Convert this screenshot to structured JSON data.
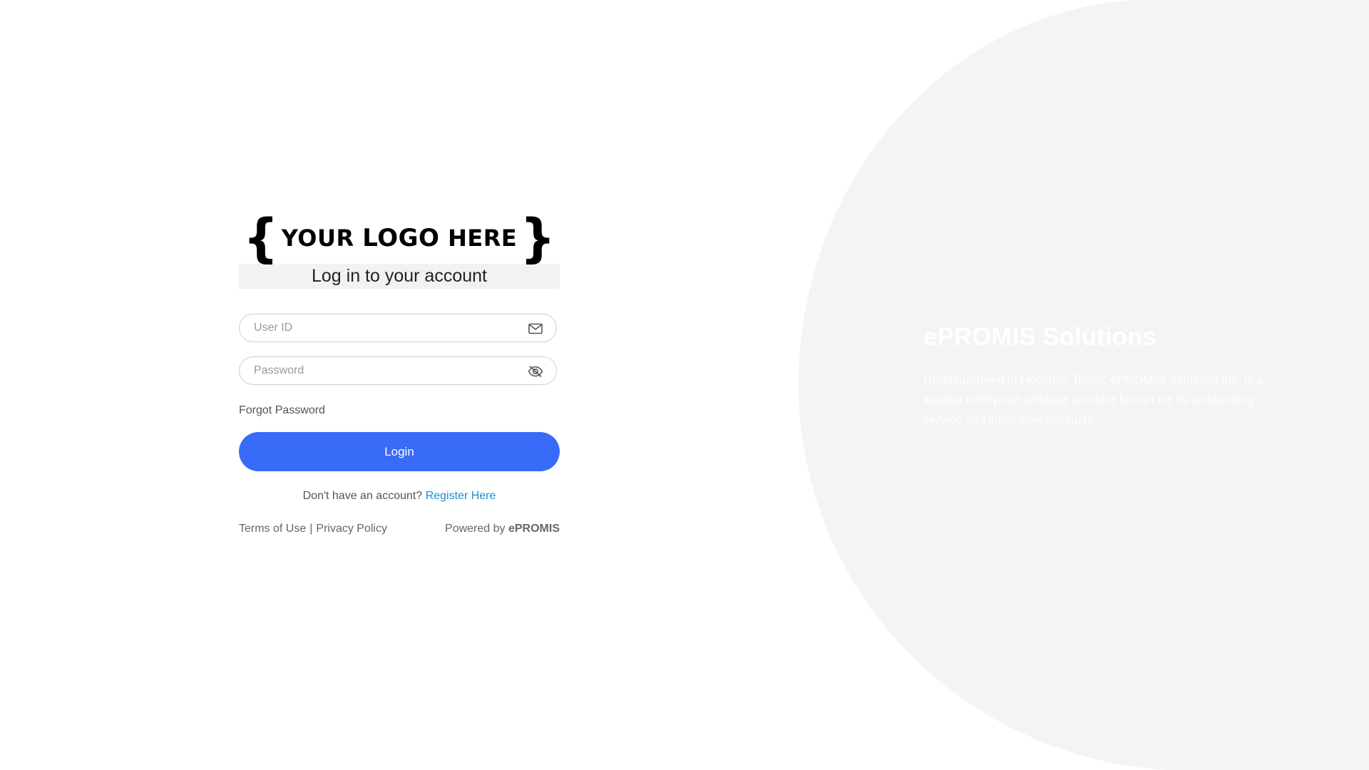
{
  "logo": {
    "open_brace": "{",
    "text_your": "YOUR",
    "text_logo": "LOGO",
    "text_here": "HERE",
    "close_brace": "}"
  },
  "login": {
    "title": "Log in to your account",
    "user_id_placeholder": "User ID",
    "user_id_value": "",
    "password_placeholder": "Password",
    "password_value": "",
    "forgot_password": "Forgot Password",
    "login_button": "Login",
    "no_account_text": "Don't have an account?",
    "register_link": "Register Here"
  },
  "footer": {
    "terms": "Terms of Use",
    "separator": "|",
    "privacy": "Privacy Policy",
    "powered_by": "Powered by",
    "brand": "ePROMIS"
  },
  "info_panel": {
    "title": "ePROMIS Solutions",
    "description": "Headquartered in Houston, Texas, ePROMIS Solutions Inc. is a leading enterprise software provider known for its outstanding service and innovative products."
  },
  "colors": {
    "primary_button": "#386bf7",
    "link": "#1b8fd1",
    "panel_background": "#f4f4f4"
  },
  "icons": {
    "user_field_icon": "mail-icon",
    "password_field_icon": "eye-slash-icon"
  }
}
